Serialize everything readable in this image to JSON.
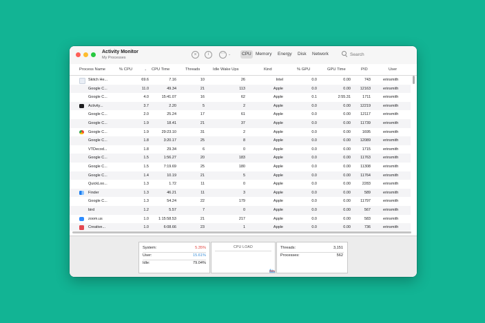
{
  "window": {
    "title": "Activity Monitor",
    "subtitle": "My Processes"
  },
  "toolbar": {
    "stop_icon": "stop-x-icon",
    "info_icon": "info-icon",
    "more_icon": "ellipsis-menu-icon",
    "chevron": "⌄",
    "tabs": [
      "CPU",
      "Memory",
      "Energy",
      "Disk",
      "Network"
    ],
    "active_tab": "CPU",
    "search_placeholder": "Search"
  },
  "columns": {
    "process_name": "Process Name",
    "cpu_pct": "% CPU",
    "cpu_time": "CPU Time",
    "threads": "Threads",
    "idle_wake_ups": "Idle Wake Ups",
    "kind": "Kind",
    "gpu_pct": "% GPU",
    "gpu_time": "GPU Time",
    "pid": "PID",
    "user": "User",
    "sort_indicator": "⌄"
  },
  "processes": [
    {
      "name": "Skitch He...",
      "cpu": "69.6",
      "cpu_time": "7.16",
      "threads": "10",
      "idle": "26",
      "kind": "Intel",
      "gpu": "0.0",
      "gpu_time": "0.00",
      "pid": "743",
      "user": "erinsmith",
      "icon": "skitch-icon"
    },
    {
      "name": "Google C...",
      "cpu": "11.0",
      "cpu_time": "49.34",
      "threads": "21",
      "idle": "113",
      "kind": "Apple",
      "gpu": "0.0",
      "gpu_time": "0.00",
      "pid": "12163",
      "user": "erinsmith",
      "icon": ""
    },
    {
      "name": "Google C...",
      "cpu": "4.0",
      "cpu_time": "15:41.07",
      "threads": "16",
      "idle": "62",
      "kind": "Apple",
      "gpu": "0.1",
      "gpu_time": "2:55.31",
      "pid": "1711",
      "user": "erinsmith",
      "icon": ""
    },
    {
      "name": "Activity...",
      "cpu": "3.7",
      "cpu_time": "2.20",
      "threads": "5",
      "idle": "2",
      "kind": "Apple",
      "gpu": "0.0",
      "gpu_time": "0.00",
      "pid": "12219",
      "user": "erinsmith",
      "icon": "activity-monitor-icon"
    },
    {
      "name": "Google C...",
      "cpu": "2.0",
      "cpu_time": "25.24",
      "threads": "17",
      "idle": "61",
      "kind": "Apple",
      "gpu": "0.0",
      "gpu_time": "0.00",
      "pid": "12117",
      "user": "erinsmith",
      "icon": ""
    },
    {
      "name": "Google C...",
      "cpu": "1.9",
      "cpu_time": "18.41",
      "threads": "21",
      "idle": "37",
      "kind": "Apple",
      "gpu": "0.0",
      "gpu_time": "0.00",
      "pid": "11739",
      "user": "erinsmith",
      "icon": ""
    },
    {
      "name": "Google C...",
      "cpu": "1.9",
      "cpu_time": "29:23.10",
      "threads": "31",
      "idle": "2",
      "kind": "Apple",
      "gpu": "0.0",
      "gpu_time": "0.00",
      "pid": "1695",
      "user": "erinsmith",
      "icon": "chrome-icon"
    },
    {
      "name": "Google C...",
      "cpu": "1.8",
      "cpu_time": "3:20.17",
      "threads": "25",
      "idle": "8",
      "kind": "Apple",
      "gpu": "0.0",
      "gpu_time": "0.00",
      "pid": "12089",
      "user": "erinsmith",
      "icon": ""
    },
    {
      "name": "VTDecod...",
      "cpu": "1.8",
      "cpu_time": "29.34",
      "threads": "6",
      "idle": "0",
      "kind": "Apple",
      "gpu": "0.0",
      "gpu_time": "0.00",
      "pid": "1715",
      "user": "erinsmith",
      "icon": ""
    },
    {
      "name": "Google C...",
      "cpu": "1.5",
      "cpu_time": "1:56.27",
      "threads": "20",
      "idle": "183",
      "kind": "Apple",
      "gpu": "0.0",
      "gpu_time": "0.00",
      "pid": "11763",
      "user": "erinsmith",
      "icon": ""
    },
    {
      "name": "Google C...",
      "cpu": "1.5",
      "cpu_time": "7:19.69",
      "threads": "25",
      "idle": "180",
      "kind": "Apple",
      "gpu": "0.0",
      "gpu_time": "0.00",
      "pid": "11308",
      "user": "erinsmith",
      "icon": ""
    },
    {
      "name": "Google C...",
      "cpu": "1.4",
      "cpu_time": "10.19",
      "threads": "21",
      "idle": "5",
      "kind": "Apple",
      "gpu": "0.0",
      "gpu_time": "0.00",
      "pid": "11764",
      "user": "erinsmith",
      "icon": ""
    },
    {
      "name": "QuickLoo...",
      "cpu": "1.3",
      "cpu_time": "1.72",
      "threads": "11",
      "idle": "0",
      "kind": "Apple",
      "gpu": "0.0",
      "gpu_time": "0.00",
      "pid": "2283",
      "user": "erinsmith",
      "icon": ""
    },
    {
      "name": "Finder",
      "cpu": "1.3",
      "cpu_time": "46.21",
      "threads": "11",
      "idle": "3",
      "kind": "Apple",
      "gpu": "0.0",
      "gpu_time": "0.00",
      "pid": "589",
      "user": "erinsmith",
      "icon": "finder-icon"
    },
    {
      "name": "Google C...",
      "cpu": "1.3",
      "cpu_time": "54.24",
      "threads": "22",
      "idle": "179",
      "kind": "Apple",
      "gpu": "0.0",
      "gpu_time": "0.00",
      "pid": "11797",
      "user": "erinsmith",
      "icon": ""
    },
    {
      "name": "bird",
      "cpu": "1.2",
      "cpu_time": "5.57",
      "threads": "7",
      "idle": "0",
      "kind": "Apple",
      "gpu": "0.0",
      "gpu_time": "0.00",
      "pid": "567",
      "user": "erinsmith",
      "icon": ""
    },
    {
      "name": "zoom.us",
      "cpu": "1.0",
      "cpu_time": "1:15:58.53",
      "threads": "21",
      "idle": "217",
      "kind": "Apple",
      "gpu": "0.0",
      "gpu_time": "0.00",
      "pid": "583",
      "user": "erinsmith",
      "icon": "zoom-icon"
    },
    {
      "name": "Creative...",
      "cpu": "1.0",
      "cpu_time": "6:08.66",
      "threads": "23",
      "idle": "1",
      "kind": "Apple",
      "gpu": "0.0",
      "gpu_time": "0.00",
      "pid": "736",
      "user": "erinsmith",
      "icon": "creative-cloud-icon"
    }
  ],
  "stats": {
    "system_label": "System:",
    "system_value": "5.35%",
    "user_label": "User:",
    "user_value": "15.61%",
    "idle_label": "Idle:",
    "idle_value": "79.04%",
    "cpu_load_title": "CPU LOAD",
    "threads_label": "Threads:",
    "threads_value": "3,151",
    "processes_label": "Processes:",
    "processes_value": "562"
  },
  "colors": {
    "background": "#12b494",
    "system_red": "#e0443e",
    "user_blue": "#3b8fd9",
    "close": "#fe5f57",
    "minimize": "#febc2e",
    "zoom": "#28c840"
  }
}
